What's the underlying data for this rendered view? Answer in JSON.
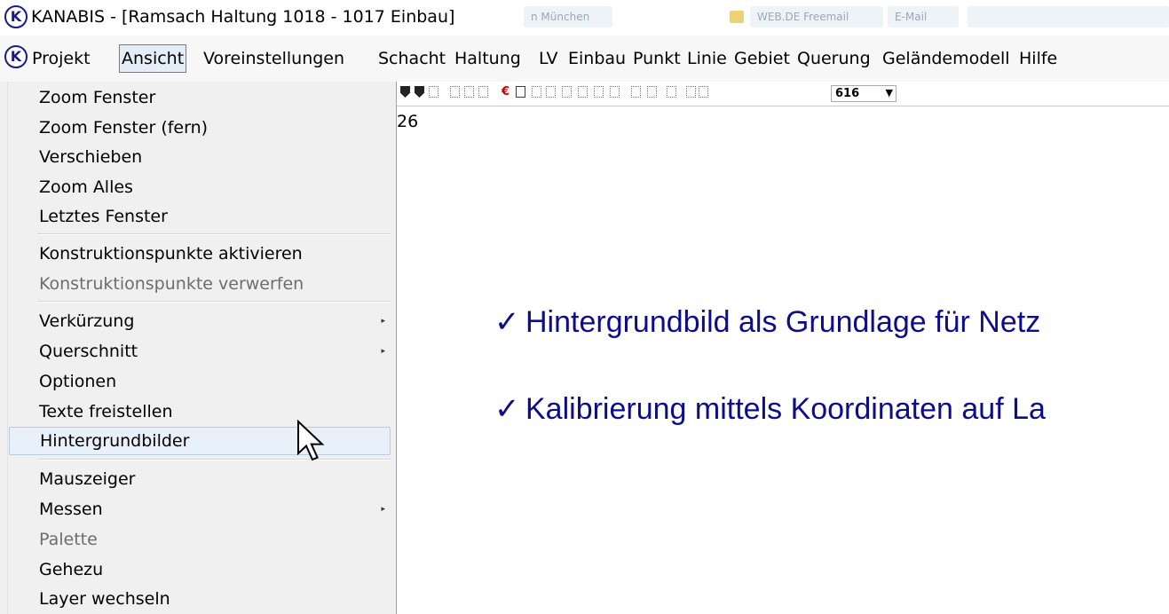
{
  "window": {
    "title": "KANABIS - [Ramsach   Haltung 1018 - 1017 Einbau]",
    "logo_letter": "K",
    "background_tabs": [
      "n München",
      "WEB.DE Freemail",
      "E-Mail"
    ]
  },
  "menubar": {
    "logo_letter": "K",
    "items": [
      "Projekt",
      "Ansicht",
      "Voreinstellungen",
      "Schacht",
      "Haltung",
      "LV",
      "Einbau",
      "Punkt",
      "Linie",
      "Gebiet",
      "Querung",
      "Geländemodell",
      "Hilfe"
    ],
    "active_item": "Ansicht"
  },
  "toolbar": {
    "zoom_value": "616"
  },
  "status_fragment": "26",
  "dropdown": {
    "items": [
      {
        "label": "Zoom Fenster",
        "enabled": true,
        "submenu": false
      },
      {
        "label": "Zoom Fenster (fern)",
        "enabled": true,
        "submenu": false
      },
      {
        "label": "Verschieben",
        "enabled": true,
        "submenu": false
      },
      {
        "label": "Zoom Alles",
        "enabled": true,
        "submenu": false
      },
      {
        "label": "Letztes Fenster",
        "enabled": true,
        "submenu": false
      },
      {
        "label": "Konstruktionspunkte aktivieren",
        "enabled": true,
        "submenu": false
      },
      {
        "label": "Konstruktionspunkte verwerfen",
        "enabled": false,
        "submenu": false
      },
      {
        "label": "Verkürzung",
        "enabled": true,
        "submenu": true
      },
      {
        "label": "Querschnitt",
        "enabled": true,
        "submenu": true
      },
      {
        "label": "Optionen",
        "enabled": true,
        "submenu": false
      },
      {
        "label": "Texte freistellen",
        "enabled": true,
        "submenu": false
      },
      {
        "label": "Hintergrundbilder",
        "enabled": true,
        "submenu": false,
        "highlighted": true
      },
      {
        "label": "Mauszeiger",
        "enabled": true,
        "submenu": false
      },
      {
        "label": "Messen",
        "enabled": true,
        "submenu": true
      },
      {
        "label": "Palette",
        "enabled": false,
        "submenu": false
      },
      {
        "label": "Gehezu",
        "enabled": true,
        "submenu": false
      },
      {
        "label": "Layer wechseln",
        "enabled": true,
        "submenu": false
      }
    ],
    "submenu_arrow": "▸"
  },
  "slide": {
    "check_symbol": "✓",
    "bullets": [
      "Hintergrundbild als Grundlage für Netz",
      "Kalibrierung mittels Koordinaten auf La"
    ],
    "bullet_color": "#0d0d8a"
  },
  "colors": {
    "menu_highlight": "#e4eef9",
    "dropdown_background": "#f0f0f0",
    "logo_blue": "#1a1a8c"
  }
}
